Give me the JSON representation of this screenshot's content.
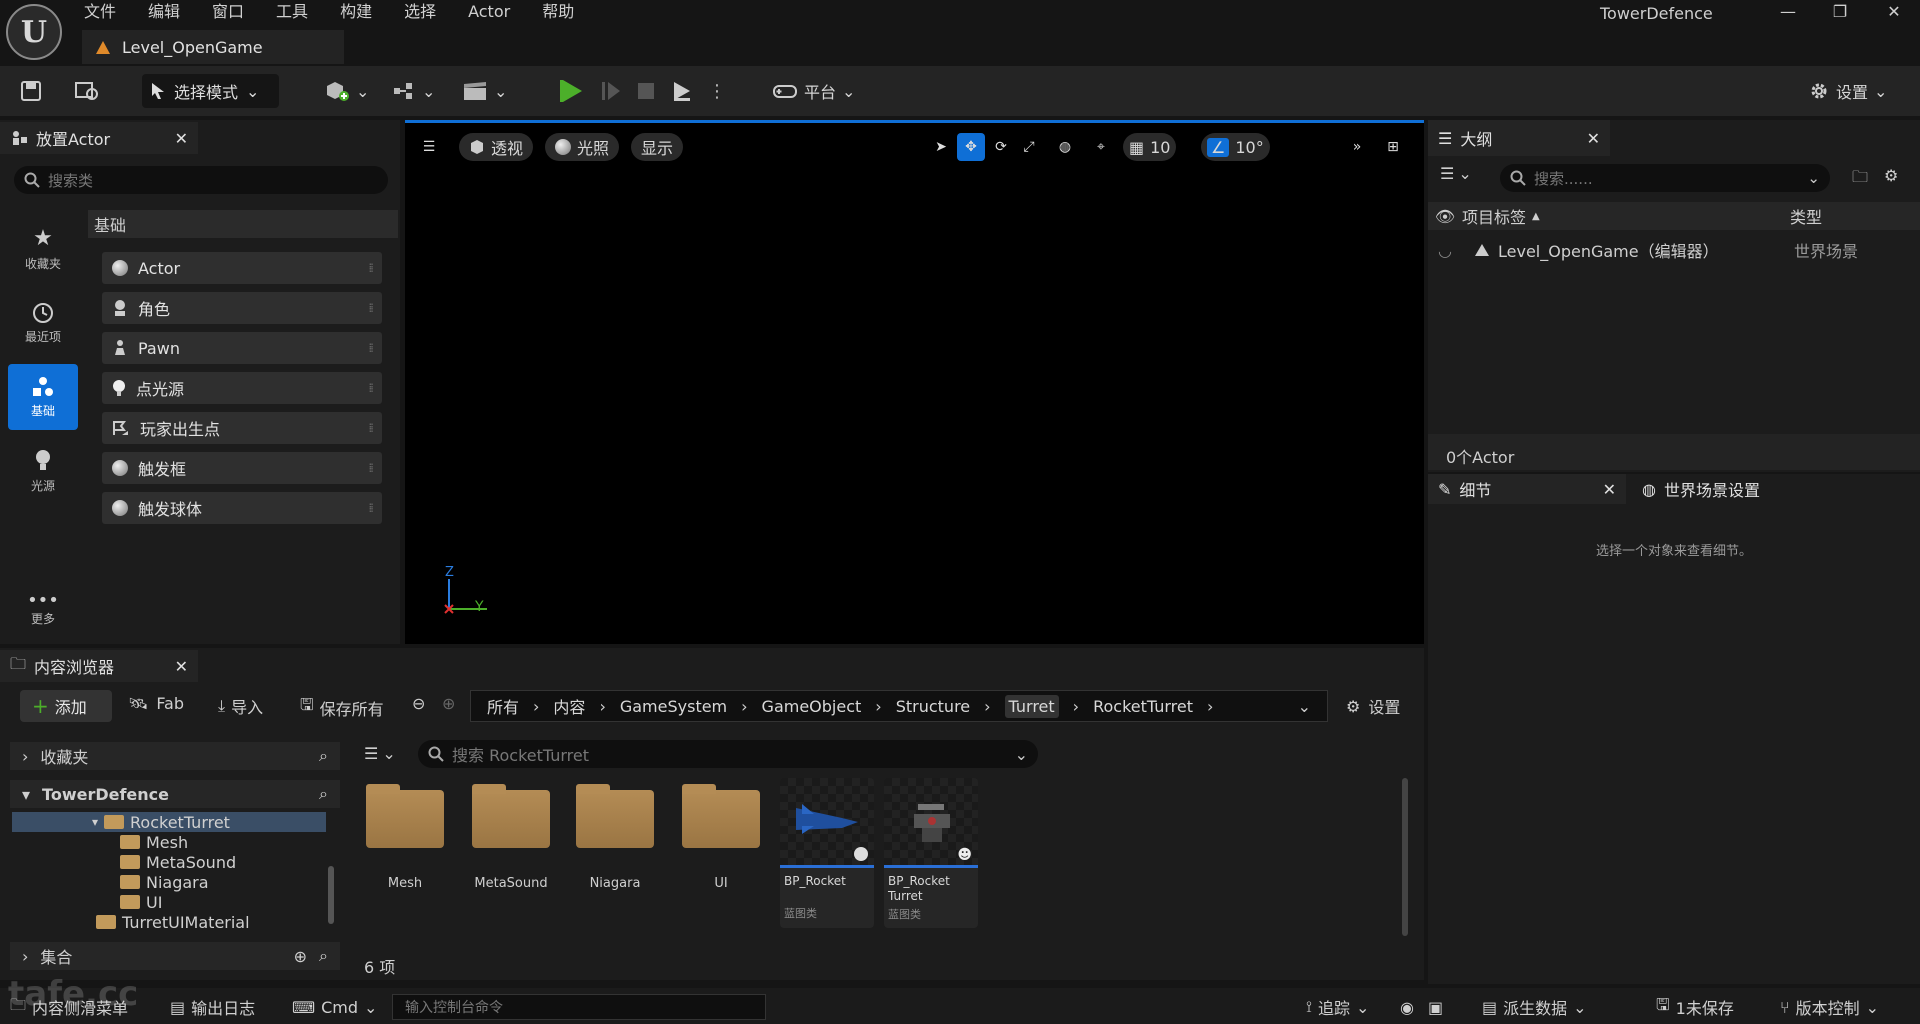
{
  "menu": [
    "文件",
    "编辑",
    "窗口",
    "工具",
    "构建",
    "选择",
    "Actor",
    "帮助"
  ],
  "project_title": "TowerDefence",
  "document_tab": "Level_OpenGame",
  "toolbar": {
    "mode_label": "选择模式",
    "platform_label": "平台",
    "settings_label": "设置"
  },
  "place_actor": {
    "tab_label": "放置Actor",
    "search_placeholder": "搜索类",
    "section_header": "基础",
    "categories": [
      {
        "label": "收藏夹",
        "icon": "star-icon"
      },
      {
        "label": "最近项",
        "icon": "clock-icon"
      },
      {
        "label": "基础",
        "icon": "shapes-icon",
        "active": true
      },
      {
        "label": "光源",
        "icon": "lightbulb-icon"
      },
      {
        "label": "更多",
        "icon": "more-icon"
      }
    ],
    "items": [
      {
        "label": "Actor",
        "icon": "sphere-icon"
      },
      {
        "label": "角色",
        "icon": "character-icon"
      },
      {
        "label": "Pawn",
        "icon": "pawn-icon"
      },
      {
        "label": "点光源",
        "icon": "point-light-icon"
      },
      {
        "label": "玩家出生点",
        "icon": "player-start-icon"
      },
      {
        "label": "触发框",
        "icon": "trigger-box-icon"
      },
      {
        "label": "触发球体",
        "icon": "trigger-sphere-icon"
      }
    ]
  },
  "viewport": {
    "perspective_label": "透视",
    "lighting_label": "光照",
    "show_label": "显示",
    "grid_snap_value": "10",
    "rotation_snap_value": "10°",
    "axis_z": "Z",
    "axis_y": "Y"
  },
  "outliner": {
    "tab_label": "大纲",
    "search_placeholder": "搜索......",
    "col_label": "项目标签",
    "col_type": "类型",
    "row_label": "Level_OpenGame（编辑器）",
    "row_type": "世界场景",
    "count": "0个Actor"
  },
  "details": {
    "tab_label": "细节",
    "world_settings_label": "世界场景设置",
    "empty_message": "选择一个对象来查看细节。"
  },
  "content_browser": {
    "tab_label": "内容浏览器",
    "add_label": "添加",
    "fab_label": "Fab",
    "import_label": "导入",
    "save_all_label": "保存所有",
    "settings_label": "设置",
    "breadcrumbs": [
      "所有",
      "内容",
      "GameSystem",
      "GameObject",
      "Structure",
      "Turret",
      "RocketTurret"
    ],
    "favorites_label": "收藏夹",
    "project_label": "TowerDefence",
    "collections_label": "集合",
    "tree": [
      {
        "label": "RocketTurret",
        "selected": true
      },
      {
        "label": "Mesh"
      },
      {
        "label": "MetaSound"
      },
      {
        "label": "Niagara"
      },
      {
        "label": "UI"
      },
      {
        "label": "TurretUIMaterial"
      }
    ],
    "search_placeholder": "搜索 RocketTurret",
    "folders": [
      "Mesh",
      "MetaSound",
      "Niagara",
      "UI"
    ],
    "assets": [
      {
        "name": "BP_Rocket",
        "type": "蓝图类"
      },
      {
        "name_line1": "BP_Rocket",
        "name_line2": "Turret",
        "type": "蓝图类"
      }
    ],
    "item_count": "6 项"
  },
  "statusbar": {
    "drawer_label": "内容侧滑菜单",
    "output_log_label": "输出日志",
    "cmd_label": "Cmd",
    "console_placeholder": "输入控制台命令",
    "trace_label": "追踪",
    "derived_data_label": "派生数据",
    "unsaved_label": "1未保存",
    "source_control_label": "版本控制"
  },
  "watermark": "tafe.cc",
  "colors": {
    "accent": "#0f6fd6",
    "folder": "#b48c55",
    "play_green": "#4caf2a"
  }
}
